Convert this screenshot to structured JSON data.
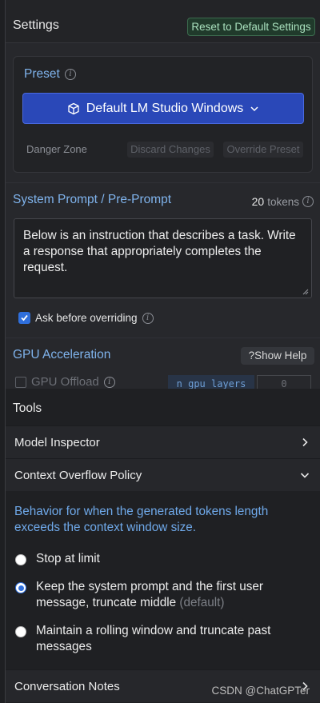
{
  "header": {
    "title": "Settings",
    "reset_label": "Reset to Default Settings"
  },
  "preset": {
    "label": "Preset",
    "selected": "Default LM Studio Windows",
    "danger_label": "Danger Zone",
    "discard_label": "Discard Changes",
    "override_label": "Override Preset"
  },
  "system_prompt": {
    "title": "System Prompt / Pre-Prompt",
    "token_count": "20",
    "token_unit": "tokens",
    "text": "Below is an instruction that describes a task. Write a response that appropriately completes the request.",
    "ask_label": "Ask before overriding",
    "ask_checked": true
  },
  "gpu": {
    "title": "GPU Acceleration",
    "help_label": "Show Help",
    "offload_label": "GPU Offload",
    "n_gpu_label": "n_gpu_layers",
    "n_gpu_value": "0"
  },
  "tools": {
    "title": "Tools",
    "items": [
      {
        "label": "Model Inspector",
        "expanded": false
      },
      {
        "label": "Context Overflow Policy",
        "expanded": true
      },
      {
        "label": "Conversation Notes",
        "expanded": false
      }
    ],
    "overflow_desc": "Behavior for when the generated tokens length exceeds the context window size.",
    "options": [
      {
        "label": "Stop at limit",
        "suffix": "",
        "selected": false
      },
      {
        "label": "Keep the system prompt and the first user message, truncate middle",
        "suffix": "(default)",
        "selected": true
      },
      {
        "label": "Maintain a rolling window and truncate past messages",
        "suffix": "",
        "selected": false
      }
    ]
  },
  "watermark": "CSDN @ChatGPTer",
  "colors": {
    "accent_blue": "#7fb3ec",
    "select_blue": "#2a48b8",
    "reset_green": "#a9e0bd"
  }
}
